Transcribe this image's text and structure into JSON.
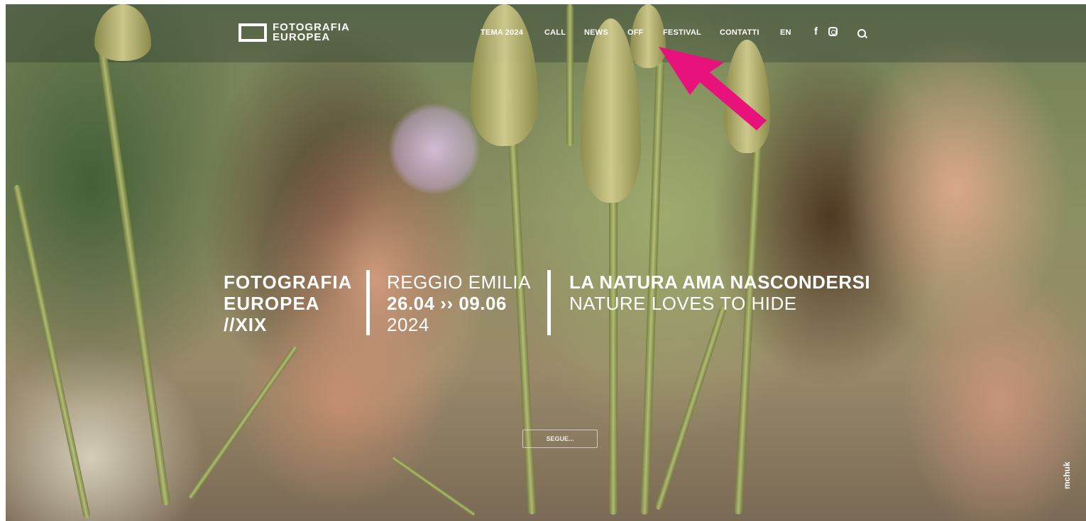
{
  "header": {
    "logo_line1": "FOTOGRAFIA",
    "logo_line2": "EUROPEA",
    "nav": [
      {
        "label": "TEMA 2024"
      },
      {
        "label": "CALL"
      },
      {
        "label": "NEWS"
      },
      {
        "label": "OFF"
      },
      {
        "label": "FESTIVAL"
      },
      {
        "label": "CONTATTI"
      },
      {
        "label": "EN"
      }
    ],
    "icons": [
      "facebook-icon",
      "instagram-icon",
      "search-icon"
    ]
  },
  "hero": {
    "col1": {
      "line1": "FOTOGRAFIA",
      "line2": "EUROPEA",
      "line3": "//XIX"
    },
    "col2": {
      "line1": "REGGIO EMILIA",
      "line2": "26.04 ›› 09.06",
      "line3": "2024"
    },
    "col3": {
      "line1": "LA NATURA AMA NASCONDERSI",
      "line2": "NATURE LOVES TO HIDE"
    },
    "cta_label": "SEGUE...",
    "credit": "mchuk"
  },
  "colors": {
    "annotation_arrow": "#e8127c",
    "text": "#ffffff"
  }
}
